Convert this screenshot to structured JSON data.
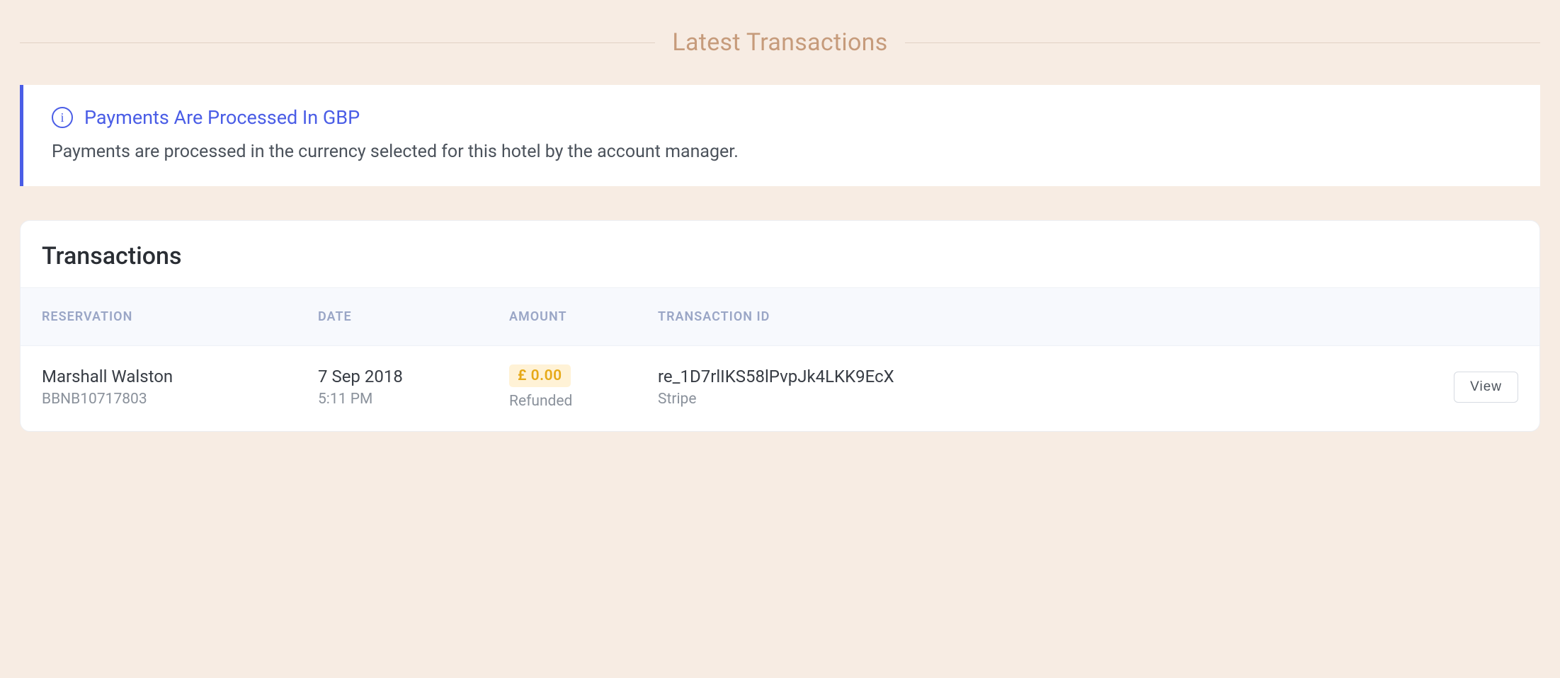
{
  "section_title": "Latest Transactions",
  "alert": {
    "icon_glyph": "i",
    "title": "Payments Are Processed In GBP",
    "body": "Payments are processed in the currency selected for this hotel by the account manager."
  },
  "card": {
    "title": "Transactions",
    "columns": {
      "reservation": "RESERVATION",
      "date": "DATE",
      "amount": "AMOUNT",
      "transaction_id": "TRANSACTION ID"
    },
    "rows": [
      {
        "name": "Marshall Walston",
        "ref": "BBNB10717803",
        "date": "7 Sep 2018",
        "time": "5:11 PM",
        "amount": "£ 0.00",
        "status": "Refunded",
        "tx_id": "re_1D7rlIKS58lPvpJk4LKK9EcX",
        "provider": "Stripe",
        "action_label": "View"
      }
    ]
  }
}
